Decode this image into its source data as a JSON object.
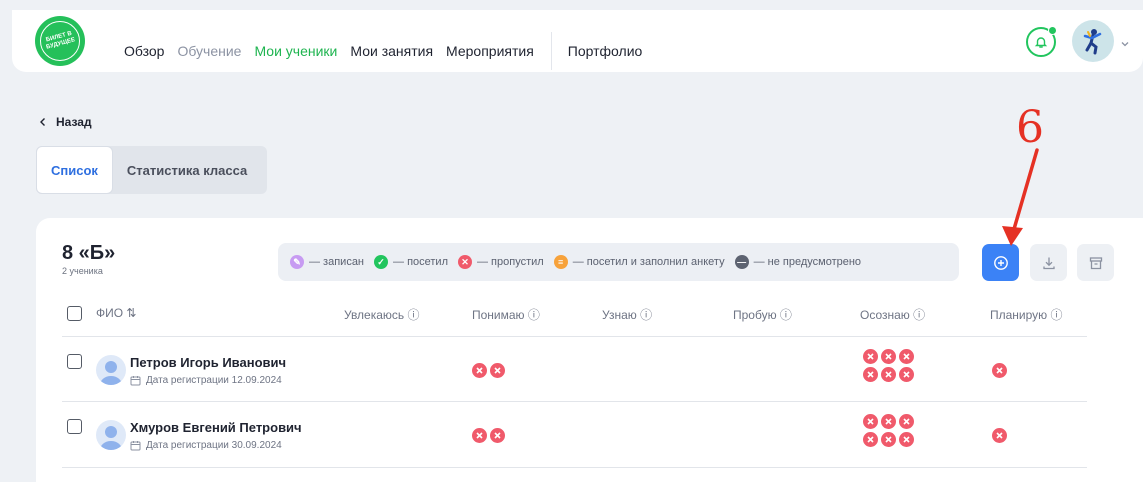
{
  "topbar": {
    "logo_text": "БИЛЕТ В БУДУЩЕЕ",
    "nav": [
      {
        "label": "Обзор",
        "state": "normal"
      },
      {
        "label": "Обучение",
        "state": "muted"
      },
      {
        "label": "Мои ученики",
        "state": "active"
      },
      {
        "label": "Мои занятия",
        "state": "normal"
      },
      {
        "label": "Мероприятия",
        "state": "normal"
      }
    ],
    "nav_after_sep": "Портфолио",
    "icons": [
      "bell-icon",
      "avatar",
      "chevron-down-icon"
    ]
  },
  "back_label": "Назад",
  "tabs": [
    {
      "label": "Список",
      "active": true
    },
    {
      "label": "Статистика класса",
      "active": false
    }
  ],
  "class": {
    "title": "8 «Б»",
    "subtitle": "2 ученика"
  },
  "legend": [
    {
      "label": "— записан",
      "color": "#c79bf2",
      "glyph": "✎"
    },
    {
      "label": "— посетил",
      "color": "#22c55e",
      "glyph": "✓"
    },
    {
      "label": "— пропустил",
      "color": "#f05a6b",
      "glyph": "✕"
    },
    {
      "label": "— посетил и заполнил анкету",
      "color": "#f7a23b",
      "glyph": "≡"
    },
    {
      "label": "— не предусмотрено",
      "color": "#5d6371",
      "glyph": "—"
    }
  ],
  "actions": [
    "add-circle-icon",
    "download-icon",
    "archive-icon"
  ],
  "annotation": {
    "number": "6",
    "color": "#e53124"
  },
  "table": {
    "headers": {
      "name": "ФИО ⇅",
      "cols": [
        "Увлекаюсь ⓘ",
        "Понимаю ⓘ",
        "Узнаю ⓘ",
        "Пробую ⓘ",
        "Осознаю ⓘ",
        "Планирую ⓘ"
      ]
    },
    "rows": [
      {
        "name": "Петров Игорь Иванович",
        "date": "Дата регистрации 12.09.2024",
        "marks": {
          "ponimayu": 2,
          "osoznayu": 6,
          "planiruyu": 1
        }
      },
      {
        "name": "Хмуров Евгений Петрович",
        "date": "Дата регистрации 30.09.2024",
        "marks": {
          "ponimayu": 2,
          "osoznayu": 6,
          "planiruyu": 1
        }
      }
    ]
  }
}
